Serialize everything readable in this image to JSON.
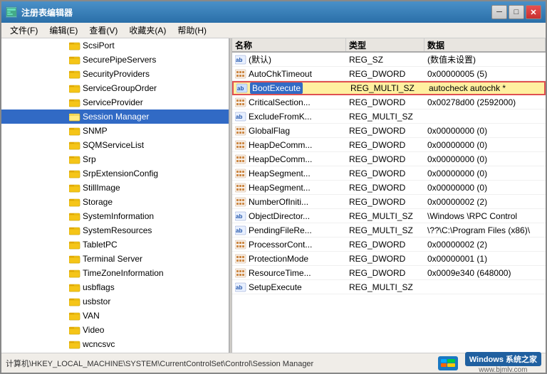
{
  "window": {
    "title": "注册表编辑器",
    "close_btn": "✕",
    "min_btn": "─",
    "max_btn": "□"
  },
  "menu": {
    "items": [
      "文件(F)",
      "编辑(E)",
      "查看(V)",
      "收藏夹(A)",
      "帮助(H)"
    ]
  },
  "tree": {
    "items": [
      {
        "label": "ScsiPort",
        "indent": 95,
        "selected": false
      },
      {
        "label": "SecurePipeServers",
        "indent": 95,
        "selected": false
      },
      {
        "label": "SecurityProviders",
        "indent": 95,
        "selected": false
      },
      {
        "label": "ServiceGroupOrder",
        "indent": 95,
        "selected": false
      },
      {
        "label": "ServiceProvider",
        "indent": 95,
        "selected": false
      },
      {
        "label": "Session Manager",
        "indent": 95,
        "selected": true
      },
      {
        "label": "SNMP",
        "indent": 95,
        "selected": false
      },
      {
        "label": "SQMServiceList",
        "indent": 95,
        "selected": false
      },
      {
        "label": "Srp",
        "indent": 95,
        "selected": false
      },
      {
        "label": "SrpExtensionConfig",
        "indent": 95,
        "selected": false
      },
      {
        "label": "StillImage",
        "indent": 95,
        "selected": false
      },
      {
        "label": "Storage",
        "indent": 95,
        "selected": false
      },
      {
        "label": "SystemInformation",
        "indent": 95,
        "selected": false
      },
      {
        "label": "SystemResources",
        "indent": 95,
        "selected": false
      },
      {
        "label": "TabletPC",
        "indent": 95,
        "selected": false
      },
      {
        "label": "Terminal Server",
        "indent": 95,
        "selected": false
      },
      {
        "label": "TimeZoneInformation",
        "indent": 95,
        "selected": false
      },
      {
        "label": "usbflags",
        "indent": 95,
        "selected": false
      },
      {
        "label": "usbstor",
        "indent": 95,
        "selected": false
      },
      {
        "label": "VAN",
        "indent": 95,
        "selected": false
      },
      {
        "label": "Video",
        "indent": 95,
        "selected": false
      },
      {
        "label": "wcncsvc",
        "indent": 95,
        "selected": false
      }
    ]
  },
  "values_header": {
    "col_name": "名称",
    "col_type": "类型",
    "col_data": "数据"
  },
  "values": [
    {
      "name": "(默认)",
      "type": "REG_SZ",
      "data": "(数值未设置)",
      "icon": "ab",
      "selected": false,
      "highlighted": false
    },
    {
      "name": "AutoChkTimeout",
      "type": "REG_DWORD",
      "data": "0x00000005 (5)",
      "icon": "dw",
      "selected": false,
      "highlighted": false
    },
    {
      "name": "BootExecute",
      "type": "REG_MULTI_SZ",
      "data": "autocheck autochk *",
      "icon": "ab",
      "selected": true,
      "highlighted": true
    },
    {
      "name": "CriticalSection...",
      "type": "REG_DWORD",
      "data": "0x00278d00 (2592000)",
      "icon": "dw",
      "selected": false,
      "highlighted": false
    },
    {
      "name": "ExcludeFromK...",
      "type": "REG_MULTI_SZ",
      "data": "",
      "icon": "ab",
      "selected": false,
      "highlighted": false
    },
    {
      "name": "GlobalFlag",
      "type": "REG_DWORD",
      "data": "0x00000000 (0)",
      "icon": "dw",
      "selected": false,
      "highlighted": false
    },
    {
      "name": "HeapDeComm...",
      "type": "REG_DWORD",
      "data": "0x00000000 (0)",
      "icon": "dw",
      "selected": false,
      "highlighted": false
    },
    {
      "name": "HeapDeComm...",
      "type": "REG_DWORD",
      "data": "0x00000000 (0)",
      "icon": "dw",
      "selected": false,
      "highlighted": false
    },
    {
      "name": "HeapSegment...",
      "type": "REG_DWORD",
      "data": "0x00000000 (0)",
      "icon": "dw",
      "selected": false,
      "highlighted": false
    },
    {
      "name": "HeapSegment...",
      "type": "REG_DWORD",
      "data": "0x00000000 (0)",
      "icon": "dw",
      "selected": false,
      "highlighted": false
    },
    {
      "name": "NumberOfIniti...",
      "type": "REG_DWORD",
      "data": "0x00000002 (2)",
      "icon": "dw",
      "selected": false,
      "highlighted": false
    },
    {
      "name": "ObjectDirector...",
      "type": "REG_MULTI_SZ",
      "data": "\\Windows \\RPC Control",
      "icon": "ab",
      "selected": false,
      "highlighted": false
    },
    {
      "name": "PendingFileRe...",
      "type": "REG_MULTI_SZ",
      "data": "\\??\\C:\\Program Files (x86)\\",
      "icon": "ab",
      "selected": false,
      "highlighted": false
    },
    {
      "name": "ProcessorCont...",
      "type": "REG_DWORD",
      "data": "0x00000002 (2)",
      "icon": "dw",
      "selected": false,
      "highlighted": false
    },
    {
      "name": "ProtectionMode",
      "type": "REG_DWORD",
      "data": "0x00000001 (1)",
      "icon": "dw",
      "selected": false,
      "highlighted": false
    },
    {
      "name": "ResourceTime...",
      "type": "REG_DWORD",
      "data": "0x0009e340 (648000)",
      "icon": "dw",
      "selected": false,
      "highlighted": false
    },
    {
      "name": "SetupExecute",
      "type": "REG_MULTI_SZ",
      "data": "",
      "icon": "ab",
      "selected": false,
      "highlighted": false
    }
  ],
  "status": {
    "path": "计算机\\HKEY_LOCAL_MACHINE\\SYSTEM\\CurrentControlSet\\Control\\Session Manager",
    "logo_text": "Windows 系统之家",
    "website": "www.bjmlv.com"
  }
}
